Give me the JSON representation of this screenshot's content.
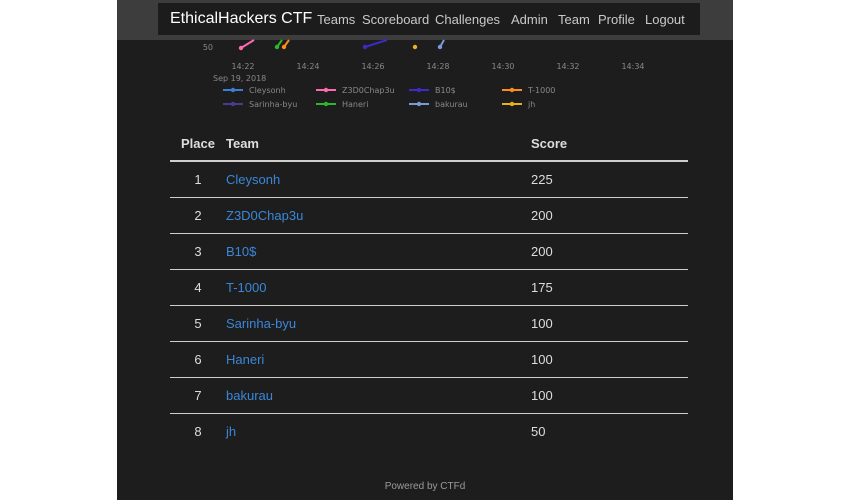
{
  "navbar": {
    "brand": "EthicalHackers CTF",
    "links": [
      "Teams",
      "Scoreboard",
      "Challenges",
      "Admin",
      "Team",
      "Profile",
      "Logout"
    ]
  },
  "chart_data": {
    "type": "line",
    "ytick_visible": "50",
    "xticks": [
      "14:22",
      "14:24",
      "14:26",
      "14:28",
      "14:30",
      "14:32",
      "14:34"
    ],
    "xdate": "Sep 19, 2018",
    "series": [
      {
        "name": "Cleysonh",
        "color": "#3a7fd4"
      },
      {
        "name": "Z3D0Chap3u",
        "color": "#ff69b4"
      },
      {
        "name": "B10$",
        "color": "#3b2bc8"
      },
      {
        "name": "T-1000",
        "color": "#ff8c1a"
      },
      {
        "name": "Sarinha-byu",
        "color": "#4b3b8f"
      },
      {
        "name": "Haneri",
        "color": "#2bb82b"
      },
      {
        "name": "bakurau",
        "color": "#7a9ad8"
      },
      {
        "name": "jh",
        "color": "#e6b31e"
      }
    ]
  },
  "table": {
    "headers": {
      "place": "Place",
      "team": "Team",
      "score": "Score"
    },
    "rows": [
      {
        "place": "1",
        "team": "Cleysonh",
        "score": "225"
      },
      {
        "place": "2",
        "team": "Z3D0Chap3u",
        "score": "200"
      },
      {
        "place": "3",
        "team": "B10$",
        "score": "200"
      },
      {
        "place": "4",
        "team": "T-1000",
        "score": "175"
      },
      {
        "place": "5",
        "team": "Sarinha-byu",
        "score": "100"
      },
      {
        "place": "6",
        "team": "Haneri",
        "score": "100"
      },
      {
        "place": "7",
        "team": "bakurau",
        "score": "100"
      },
      {
        "place": "8",
        "team": "jh",
        "score": "50"
      }
    ]
  },
  "footer": "Powered by CTFd"
}
